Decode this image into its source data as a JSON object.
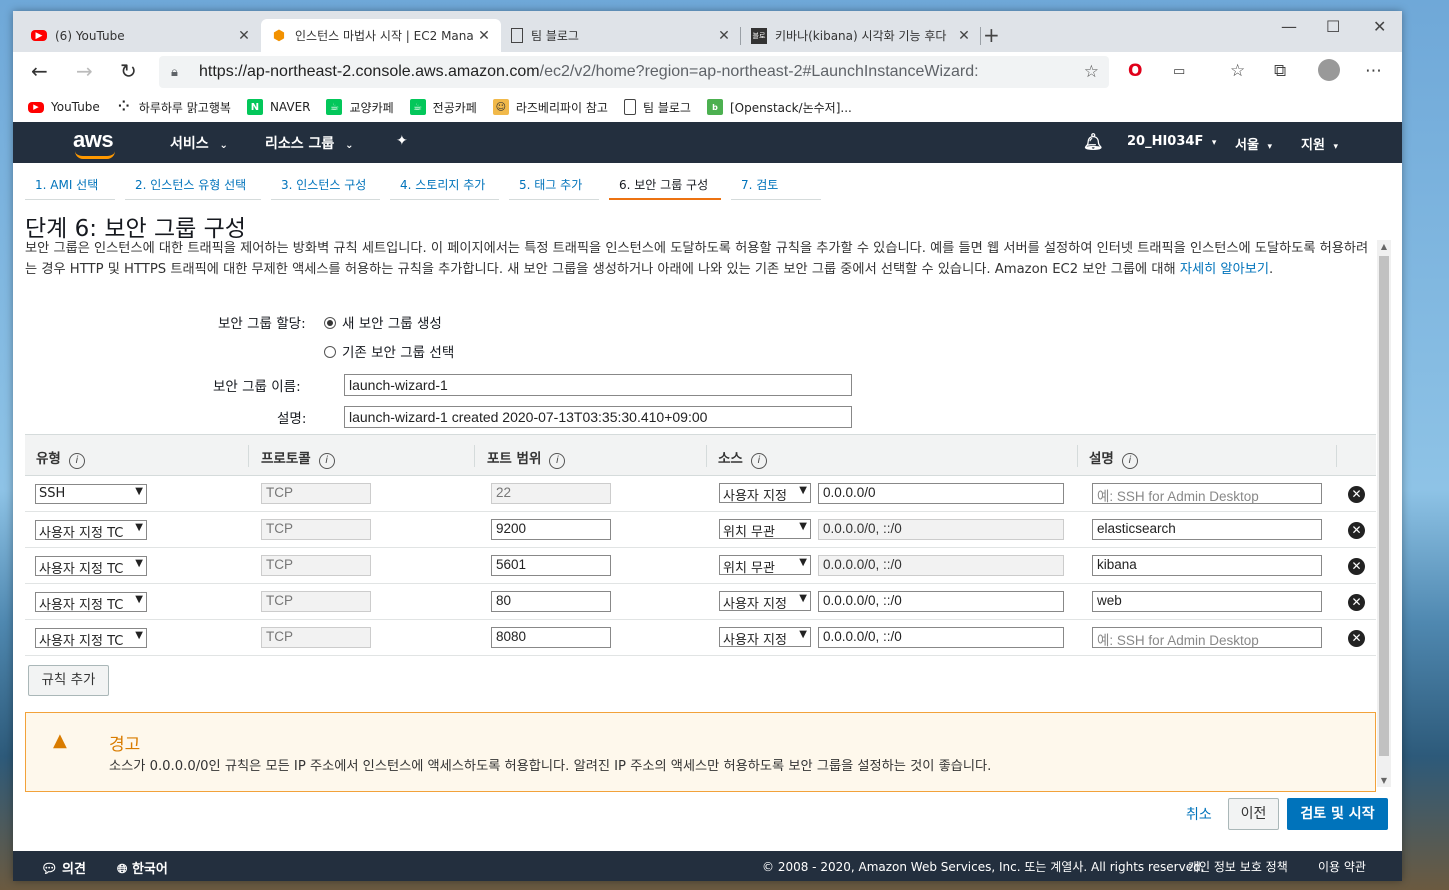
{
  "browser": {
    "tabs": [
      {
        "title": "(6) YouTube",
        "icon": "youtube-icon"
      },
      {
        "title": "인스턴스 마법사 시작 | EC2 Mana",
        "icon": "aws-icon"
      },
      {
        "title": "팀 블로그",
        "icon": "page-icon"
      },
      {
        "title": "키바나(kibana) 시각화 기능 후다",
        "icon": "blog-icon"
      }
    ],
    "url_prefix": "https://ap-northeast-2.console.aws.amazon.com",
    "url_rest": "/ec2/v2/home?region=ap-northeast-2#LaunchInstanceWizard:",
    "bookmarks": [
      {
        "label": "YouTube",
        "color": "#ff0000",
        "glyph": "▶"
      },
      {
        "label": "하루하루 맑고행복",
        "color": "#ffffff",
        "glyph": "⁘"
      },
      {
        "label": "NAVER",
        "color": "#03c75a",
        "glyph": "N"
      },
      {
        "label": "교양카페",
        "color": "#03c75a",
        "glyph": "☕"
      },
      {
        "label": "전공카페",
        "color": "#03c75a",
        "glyph": "☕"
      },
      {
        "label": "라즈베리파이 참고",
        "color": "#f1b94a",
        "glyph": "☺"
      },
      {
        "label": "팀 블로그",
        "color": "#ffffff",
        "glyph": "▯"
      },
      {
        "label": "[Openstack/논수저]...",
        "color": "#4cb050",
        "glyph": "b"
      }
    ]
  },
  "aws_nav": {
    "logo": "aws",
    "services": "서비스",
    "resource_groups": "리소스 그룹",
    "account": "20_HI034F",
    "region": "서울",
    "support": "지원"
  },
  "steps": [
    "1. AMI 선택",
    "2. 인스턴스 유형 선택",
    "3. 인스턴스 구성",
    "4. 스토리지 추가",
    "5. 태그 추가",
    "6. 보안 그룹 구성",
    "7. 검토"
  ],
  "page": {
    "heading": "단계 6: 보안 그룹 구성",
    "intro": "보안 그룹은 인스턴스에 대한 트래픽을 제어하는 방화벽 규칙 세트입니다. 이 페이지에서는 특정 트래픽을 인스턴스에 도달하도록 허용할 규칙을 추가할 수 있습니다. 예를 들면 웹 서버를 설정하여 인터넷 트래픽을 인스턴스에 도달하도록 허용하려는 경우 HTTP 및 HTTPS 트래픽에 대한 무제한 액세스를 허용하는 규칙을 추가합니다. 새 보안 그룹을 생성하거나 아래에 나와 있는 기존 보안 그룹 중에서 선택할 수 있습니다. Amazon EC2 보안 그룹에 대해 ",
    "intro_link": "자세히 알아보기",
    "intro_end": "."
  },
  "form": {
    "assign_label": "보안 그룹 할당:",
    "option_new": "새 보안 그룹 생성",
    "option_existing": "기존 보안 그룹 선택",
    "name_label": "보안 그룹 이름:",
    "name_value": "launch-wizard-1",
    "desc_label": "설명:",
    "desc_value": "launch-wizard-1 created 2020-07-13T03:35:30.410+09:00"
  },
  "table": {
    "headers": [
      "유형",
      "프로토콜",
      "포트 범위",
      "소스",
      "설명"
    ],
    "rows": [
      {
        "type": "SSH",
        "protocol": "TCP",
        "port": "22",
        "source": "사용자 지정",
        "cidr": "0.0.0.0/0",
        "desc": "예: SSH for Admin Desktop",
        "desc_placeholder": true,
        "port_ro": true,
        "cidr_ro": false
      },
      {
        "type": "사용자 지정 TC",
        "protocol": "TCP",
        "port": "9200",
        "source": "위치 무관",
        "cidr": "0.0.0.0/0, ::/0",
        "desc": "elasticsearch",
        "desc_placeholder": false,
        "port_ro": false,
        "cidr_ro": true
      },
      {
        "type": "사용자 지정 TC",
        "protocol": "TCP",
        "port": "5601",
        "source": "위치 무관",
        "cidr": "0.0.0.0/0, ::/0",
        "desc": "kibana",
        "desc_placeholder": false,
        "port_ro": false,
        "cidr_ro": true
      },
      {
        "type": "사용자 지정 TC",
        "protocol": "TCP",
        "port": "80",
        "source": "사용자 지정",
        "cidr": "0.0.0.0/0, ::/0",
        "desc": "web",
        "desc_placeholder": false,
        "port_ro": false,
        "cidr_ro": false
      },
      {
        "type": "사용자 지정 TC",
        "protocol": "TCP",
        "port": "8080",
        "source": "사용자 지정",
        "cidr": "0.0.0.0/0, ::/0",
        "desc": "예: SSH for Admin Desktop",
        "desc_placeholder": true,
        "port_ro": false,
        "cidr_ro": false
      }
    ],
    "add_rule": "규칙 추가"
  },
  "warning": {
    "title": "경고",
    "text": "소스가 0.0.0.0/0인 규칙은 모든 IP 주소에서 인스턴스에 액세스하도록 허용합니다. 알려진 IP 주소의 액세스만 허용하도록 보안 그룹을 설정하는 것이 좋습니다."
  },
  "actions": {
    "cancel": "취소",
    "previous": "이전",
    "review_launch": "검토 및 시작"
  },
  "footer": {
    "feedback": "의견",
    "language": "한국어",
    "copyright": "© 2008 - 2020, Amazon Web Services, Inc. 또는 계열사. All rights reserved.",
    "privacy": "개인 정보 보호 정책",
    "terms": "이용 약관"
  },
  "colors": {
    "aws_nav": "#232f3e",
    "accent_orange": "#ec7211",
    "link_blue": "#0073bb",
    "warning": "#d97c00"
  }
}
